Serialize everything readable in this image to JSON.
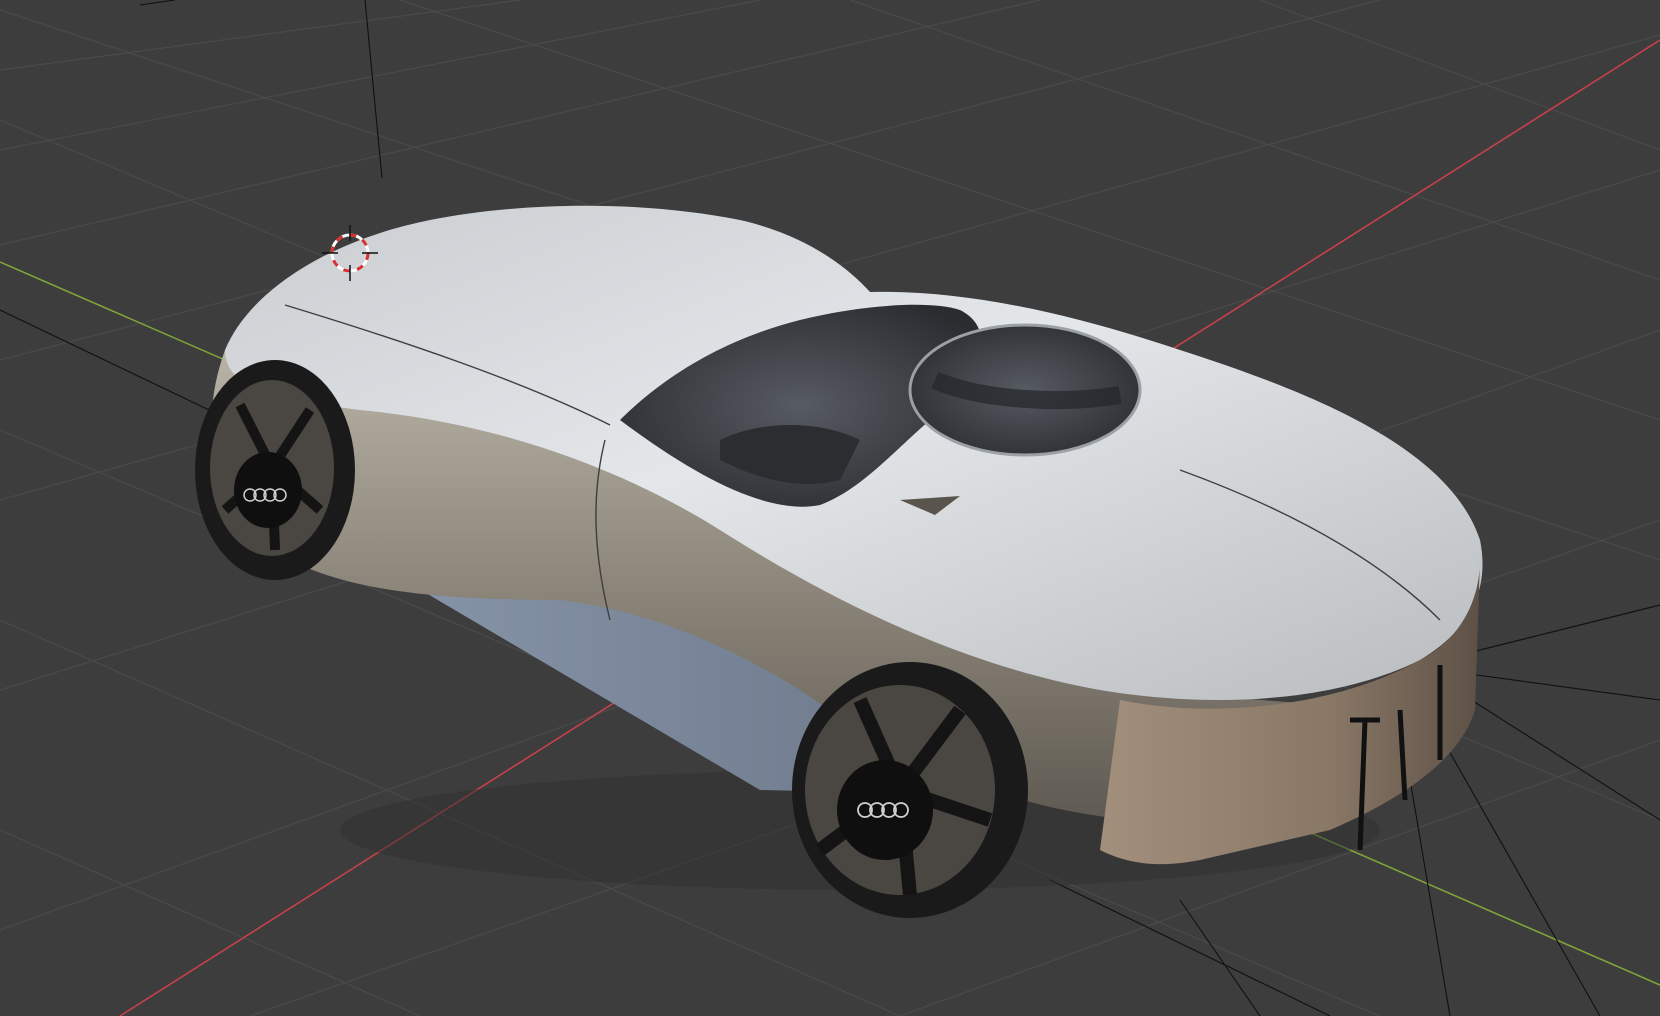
{
  "viewport": {
    "background": "#3d3d3d",
    "grid_color": "#4a4a4a",
    "x_axis_color": "#c8404a",
    "y_axis_color": "#7ea338",
    "object": "car-model",
    "badge": "audi-four-rings"
  },
  "colors": {
    "body_light": "#d9dde0",
    "body_mid": "#a6a397",
    "body_dark": "#6b655a",
    "glass": "#3b3e44",
    "underbody": "#7f8da0",
    "tire": "#1a1a1a",
    "rim": "#4a4742"
  }
}
